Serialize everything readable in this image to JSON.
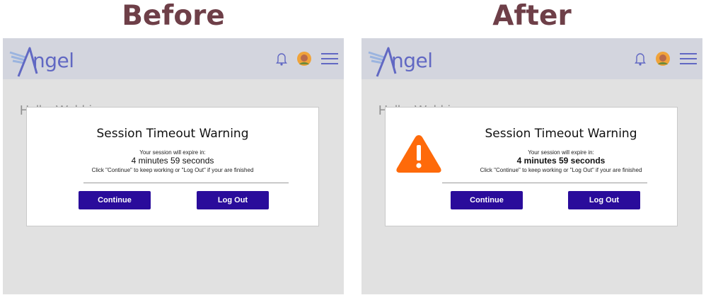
{
  "labels": {
    "before": "Before",
    "after": "After"
  },
  "app": {
    "logo_text": "ngel",
    "greeting": "Hello, Webbie"
  },
  "icons": {
    "logo": "angel-logo-icon",
    "bell": "bell-icon",
    "avatar": "avatar",
    "menu": "hamburger-menu-icon",
    "warning": "warning-triangle-icon"
  },
  "dialog": {
    "title": "Session Timeout Warning",
    "subtitle": "Your session will expire in:",
    "countdown": "4 minutes 59 seconds",
    "instructions": "Click \"Continue\" to keep working or \"Log Out\" if your are finished",
    "continue_label": "Continue",
    "logout_label": "Log Out"
  },
  "colors": {
    "heading": "#6e3f48",
    "button": "#2a0c9b",
    "appbar": "#d3d5de",
    "screen": "#e1e1e1",
    "logo": "#6168c3",
    "warning": "#fe6a0a"
  }
}
